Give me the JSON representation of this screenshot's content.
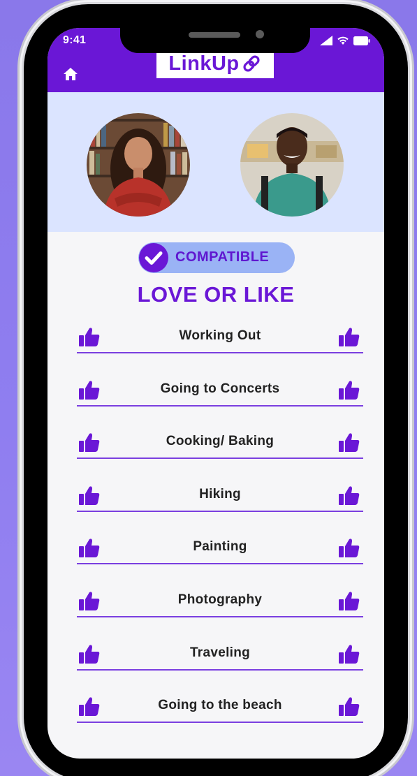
{
  "status_bar": {
    "time": "9:41",
    "icons": [
      "signal-icon",
      "wifi-icon",
      "battery-icon"
    ]
  },
  "header": {
    "logo_text": "LinkUp",
    "logo_icon": "link-icon",
    "home_icon": "home-icon",
    "colors": {
      "header_bg": "#6a17d6",
      "accent": "#6a17d6"
    }
  },
  "profiles": [
    {
      "name": "avatar-left",
      "description_icon": "user-photo"
    },
    {
      "name": "avatar-right",
      "description_icon": "user-photo"
    }
  ],
  "compatibility": {
    "badge_label": "COMPATIBLE",
    "icon": "check-icon"
  },
  "section": {
    "title": "LOVE OR LIKE"
  },
  "interests": [
    {
      "label": "Working Out"
    },
    {
      "label": "Going to Concerts"
    },
    {
      "label": "Cooking/ Baking"
    },
    {
      "label": "Hiking"
    },
    {
      "label": "Painting"
    },
    {
      "label": "Photography"
    },
    {
      "label": "Traveling"
    },
    {
      "label": "Going to the beach"
    }
  ],
  "thumb_icon": "thumbs-up-icon"
}
